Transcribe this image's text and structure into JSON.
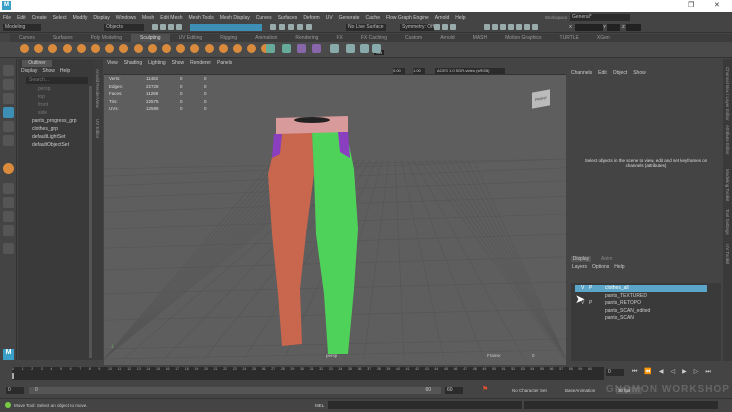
{
  "app": {
    "logo": "M",
    "window_controls": [
      "restore",
      "close"
    ]
  },
  "menu": [
    "File",
    "Edit",
    "Create",
    "Select",
    "Modify",
    "Display",
    "Windows",
    "Mesh",
    "Edit Mesh",
    "Mesh Tools",
    "Mesh Display",
    "Curves",
    "Surfaces",
    "Deform",
    "UV",
    "Generate",
    "Cache",
    "Flow Graph Engine",
    "Arnold",
    "Help"
  ],
  "workspace": {
    "label": "Workspace :",
    "value": "General*"
  },
  "status": {
    "mode": "Modeling",
    "objects": "Objects",
    "live_surface": "No Live Surface",
    "symmetry": "Symmetry: Off",
    "x": "X",
    "y": "Y",
    "z": "Z"
  },
  "shelf_tabs": [
    "Curves",
    "Surfaces",
    "Poly Modeling",
    "Sculpting",
    "UV Editing",
    "Rigging",
    "Animation",
    "Rendering",
    "FX",
    "FX Caching",
    "Custom",
    "Arnold",
    "MASH",
    "Motion Graphics",
    "TURTLE",
    "XGen"
  ],
  "shelf_active": "Sculpting",
  "shelf_set_label": "Set",
  "outliner": {
    "title": "Outliner",
    "menu": [
      "Display",
      "Show",
      "Help"
    ],
    "search_placeholder": "Search...",
    "items": [
      "persp",
      "top",
      "front",
      "side",
      "pants_progress_grp",
      "clothes_grp",
      "defaultLightSet",
      "defaultObjectSet"
    ]
  },
  "side_strip": [
    "Arnold RenderView",
    "UV Editor"
  ],
  "viewport": {
    "menu": [
      "View",
      "Shading",
      "Lighting",
      "Show",
      "Renderer",
      "Panels"
    ],
    "exposure": "0.00",
    "gamma": "1.00",
    "color_space": "ACES 1.0 SDR-video (sRGB)",
    "hud": [
      {
        "label": "Verts:",
        "v": "11482",
        "a": "0",
        "b": "0"
      },
      {
        "label": "Edges:",
        "v": "22728",
        "a": "0",
        "b": "0"
      },
      {
        "label": "Faces:",
        "v": "11288",
        "a": "0",
        "b": "0"
      },
      {
        "label": "Tris:",
        "v": "22575",
        "a": "0",
        "b": "0"
      },
      {
        "label": "UVs:",
        "v": "12589",
        "a": "0",
        "b": "0"
      }
    ],
    "camera": "persp",
    "frame_label": "Frame:",
    "frame": "0",
    "viewcube": "FRONT",
    "colors": {
      "left_leg": "#c8664e",
      "right_leg": "#4fd25a",
      "waist": "#d89a9a",
      "pocket": "#8a3fc0"
    }
  },
  "channel_box": {
    "menu": [
      "Channels",
      "Edit",
      "Object",
      "Show"
    ],
    "message": "Select objects in the scene to view, edit and set keyframes on channels (attributes)"
  },
  "layer_editor": {
    "tabs": [
      "Display",
      "Anim"
    ],
    "menu": [
      "Layers",
      "Options",
      "Help"
    ],
    "layers": [
      {
        "name": "clothes_all",
        "v": "V",
        "p": "P",
        "selected": true
      },
      {
        "name": "pants_TEXTURED",
        "v": "",
        "p": ""
      },
      {
        "name": "pants_RETOPO",
        "v": "V",
        "p": "P"
      },
      {
        "name": "pants_SCAN_edited",
        "v": "",
        "p": ""
      },
      {
        "name": "pants_SCAN",
        "v": "",
        "p": ""
      }
    ]
  },
  "right_tabs": [
    "Channel Box / Layer Editor",
    "Attribute Editor",
    "Modeling Toolkit",
    "Tool Settings",
    "UV Toolkit"
  ],
  "timeline": {
    "start": 0,
    "end": 60,
    "current": "0"
  },
  "range": {
    "start": "0",
    "inner_start": "0",
    "inner_end": "60",
    "end": "60",
    "character_set": "No Character Set",
    "anim_layer": "BaseAnimation",
    "fps": "30 fps"
  },
  "statusbar": {
    "help": "Move Tool: Select an object to move.",
    "mel": "MEL"
  },
  "watermark": "Gnomon Workshop"
}
